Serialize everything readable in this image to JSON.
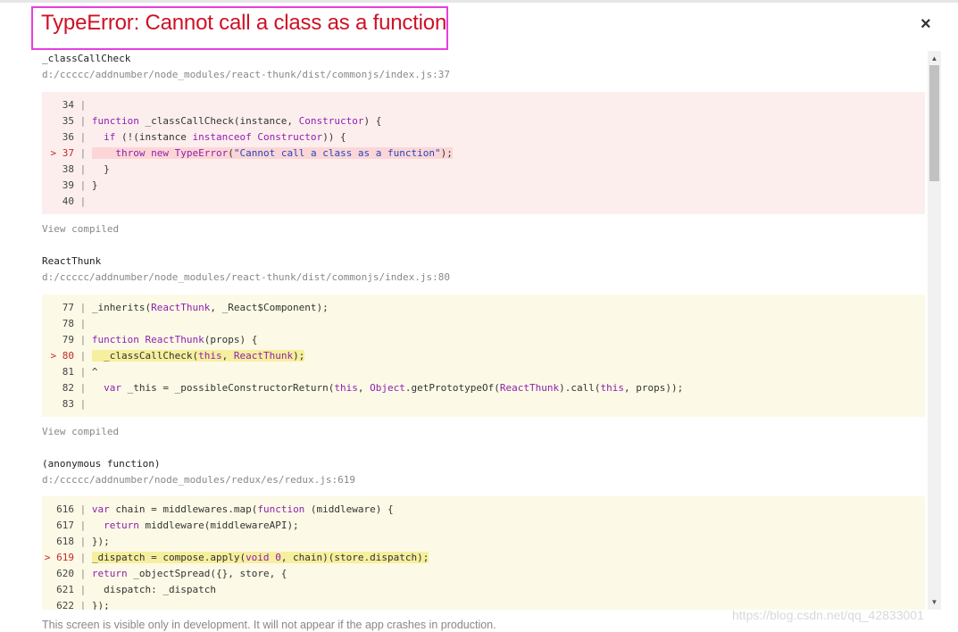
{
  "overlay": {
    "title": "TypeError: Cannot call a class as a function",
    "close_icon": "×",
    "footer": "This screen is visible only in development. It will not appear if the app crashes in production.",
    "watermark": "https://blog.csdn.net/qq_42833001"
  },
  "frames": [
    {
      "fn": "_classCallCheck",
      "file": "d:/ccccc/addnumber/node_modules/react-thunk/dist/commonjs/index.js:37",
      "view_compiled": "View compiled",
      "lines": [
        {
          "num": "34",
          "code": ""
        },
        {
          "num": "35",
          "code": "function _classCallCheck(instance, Constructor) {"
        },
        {
          "num": "36",
          "code": "  if (!(instance instanceof Constructor)) {"
        },
        {
          "num": "37",
          "code": "    throw new TypeError(\"Cannot call a class as a function\");",
          "marker": ">"
        },
        {
          "num": "38",
          "code": "  }"
        },
        {
          "num": "39",
          "code": "}"
        },
        {
          "num": "40",
          "code": ""
        }
      ]
    },
    {
      "fn": "ReactThunk",
      "file": "d:/ccccc/addnumber/node_modules/react-thunk/dist/commonjs/index.js:80",
      "view_compiled": "View compiled",
      "lines": [
        {
          "num": "77",
          "code": "_inherits(ReactThunk, _React$Component);"
        },
        {
          "num": "78",
          "code": ""
        },
        {
          "num": "79",
          "code": "function ReactThunk(props) {"
        },
        {
          "num": "80",
          "code": "  _classCallCheck(this, ReactThunk);",
          "marker": ">"
        },
        {
          "num": "81",
          "code": "^"
        },
        {
          "num": "82",
          "code": "  var _this = _possibleConstructorReturn(this, Object.getPrototypeOf(ReactThunk).call(this, props));"
        },
        {
          "num": "83",
          "code": ""
        }
      ]
    },
    {
      "fn": "(anonymous function)",
      "file": "d:/ccccc/addnumber/node_modules/redux/es/redux.js:619",
      "lines": [
        {
          "num": "616",
          "code": "var chain = middlewares.map(function (middleware) {"
        },
        {
          "num": "617",
          "code": "  return middleware(middlewareAPI);"
        },
        {
          "num": "618",
          "code": "});"
        },
        {
          "num": "619",
          "code": "_dispatch = compose.apply(void 0, chain)(store.dispatch);",
          "marker": ">"
        },
        {
          "num": "620",
          "code": "return _objectSpread({}, store, {"
        },
        {
          "num": "621",
          "code": "  dispatch: _dispatch"
        },
        {
          "num": "622",
          "code": "});"
        }
      ]
    }
  ]
}
